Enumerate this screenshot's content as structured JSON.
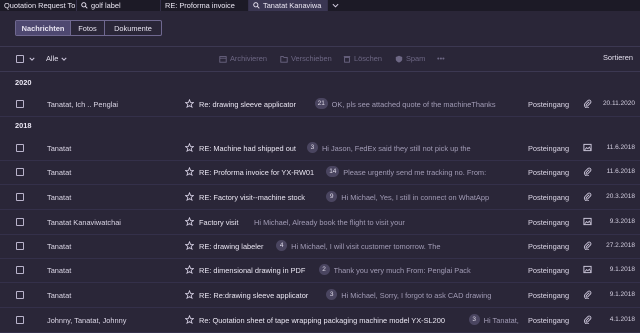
{
  "tabs": [
    {
      "label": "Quotation Request To",
      "search": false
    },
    {
      "label": "golf label",
      "search": true
    },
    {
      "label": "RE: Proforma invoice",
      "search": false
    },
    {
      "label": "Tanatat Kanaviwa",
      "search": true,
      "active": true
    }
  ],
  "segments": [
    "Nachrichten",
    "Fotos",
    "Dokumente"
  ],
  "toolbar": {
    "filter_label": "Alle",
    "archive": "Archivieren",
    "move": "Verschieben",
    "delete": "Löschen",
    "spam": "Spam",
    "more": "•••",
    "sort": "Sortieren"
  },
  "years": [
    "2020",
    "2018"
  ],
  "rows": [
    {
      "from": "Tanatat, Ich .. Penglai",
      "subject": "Re: drawing sleeve applicator",
      "count": "21",
      "preview": "OK, pls see attached quote of the machineThanks",
      "folder": "Posteingang",
      "icon": "paperclip-icon",
      "date": "20.11.2020"
    },
    {
      "from": "Tanatat",
      "subject": "RE: Machine had shipped out",
      "count": "3",
      "preview": "Hi Jason, FedEx said they still not pick up the",
      "folder": "Posteingang",
      "icon": "image-icon",
      "date": "11.6.2018"
    },
    {
      "from": "Tanatat",
      "subject": "RE: Proforma invoice for YX-RW01",
      "count": "14",
      "preview": "Please urgently send me tracking no. From:",
      "folder": "Posteingang",
      "icon": "paperclip-icon",
      "date": "11.6.2018"
    },
    {
      "from": "Tanatat",
      "subject": "RE: Factory visit--machine stock",
      "count": "9",
      "preview": "Hi Michael, Yes, I still in connect on WhatApp",
      "folder": "Posteingang",
      "icon": "paperclip-icon",
      "date": "20.3.2018"
    },
    {
      "from": "Tanatat Kanaviwatchai",
      "subject": "Factory visit",
      "count": "",
      "preview": "Hi Michael, Already book the flight to visit your",
      "folder": "Posteingang",
      "icon": "image-icon",
      "date": "9.3.2018"
    },
    {
      "from": "Tanatat",
      "subject": "RE: drawing labeler",
      "count": "4",
      "preview": "Hi Michael, I will visit customer tomorrow. The",
      "folder": "Posteingang",
      "icon": "paperclip-icon",
      "date": "27.2.2018"
    },
    {
      "from": "Tanatat",
      "subject": "RE: dimensional drawing in PDF",
      "count": "2",
      "preview": "Thank you very much From: Penglai Pack",
      "folder": "Posteingang",
      "icon": "image-icon",
      "date": "9.1.2018"
    },
    {
      "from": "Tanatat",
      "subject": "RE: Re:drawing sleeve applicator",
      "count": "3",
      "preview": "Hi Michael, Sorry, I forgot to ask CAD drawing",
      "folder": "Posteingang",
      "icon": "paperclip-icon",
      "date": "9.1.2018"
    },
    {
      "from": "Johnny, Tanatat, Johnny",
      "subject": "Re: Quotation sheet of tape wrapping packaging machine model YX-SL200",
      "count": "3",
      "preview": "Hi Tanatat, Ok, P...",
      "folder": "Posteingang",
      "icon": "paperclip-icon",
      "date": "4.1.2018"
    }
  ]
}
